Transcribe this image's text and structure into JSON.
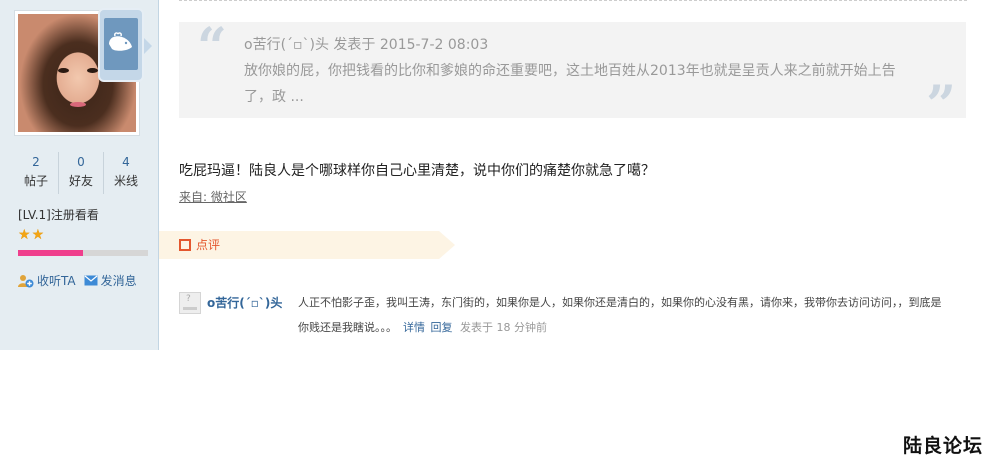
{
  "user": {
    "stats": [
      {
        "value": "2",
        "label": "帖子"
      },
      {
        "value": "0",
        "label": "好友"
      },
      {
        "value": "4",
        "label": "米线"
      }
    ],
    "level": "[LV.1]注册看看",
    "star_count": 2,
    "level_progress": 0.5,
    "actions": {
      "follow": "收听TA",
      "message": "发消息"
    }
  },
  "quote": {
    "header": "o苦行(ˊ▫ˋ)头 发表于 2015-7-2 08:03",
    "body": "放你娘的屁，你把钱看的比你和爹娘的命还重要吧，这土地百姓从2013年也就是呈贡人来之前就开始上告了，政 ...",
    "open_mark": "“",
    "close_mark": "”"
  },
  "post": {
    "text": "吃屁玛逼！陆良人是个哪球样你自己心里清楚，说中你们的痛楚你就急了噶？",
    "source": "来自: 微社区"
  },
  "comments": {
    "tab_label": "点评",
    "items": [
      {
        "user": "o苦行(ˊ▫ˋ)头",
        "text": "人正不怕影子歪，我叫王涛，东门街的，如果你是人，如果你还是清白的，如果你的心没有黑，请你来，我带你去访问访问，，到底是你贱还是我瞎说。。。",
        "detail_link": "详情",
        "reply_link": "回复",
        "time": "发表于 18 分钟前"
      }
    ]
  },
  "brand": "陆良论坛",
  "colors": {
    "accent": "#336699",
    "comment_accent": "#e4572e",
    "progress": "#ef3f8d",
    "sidebar_bg": "#e5edf2"
  }
}
